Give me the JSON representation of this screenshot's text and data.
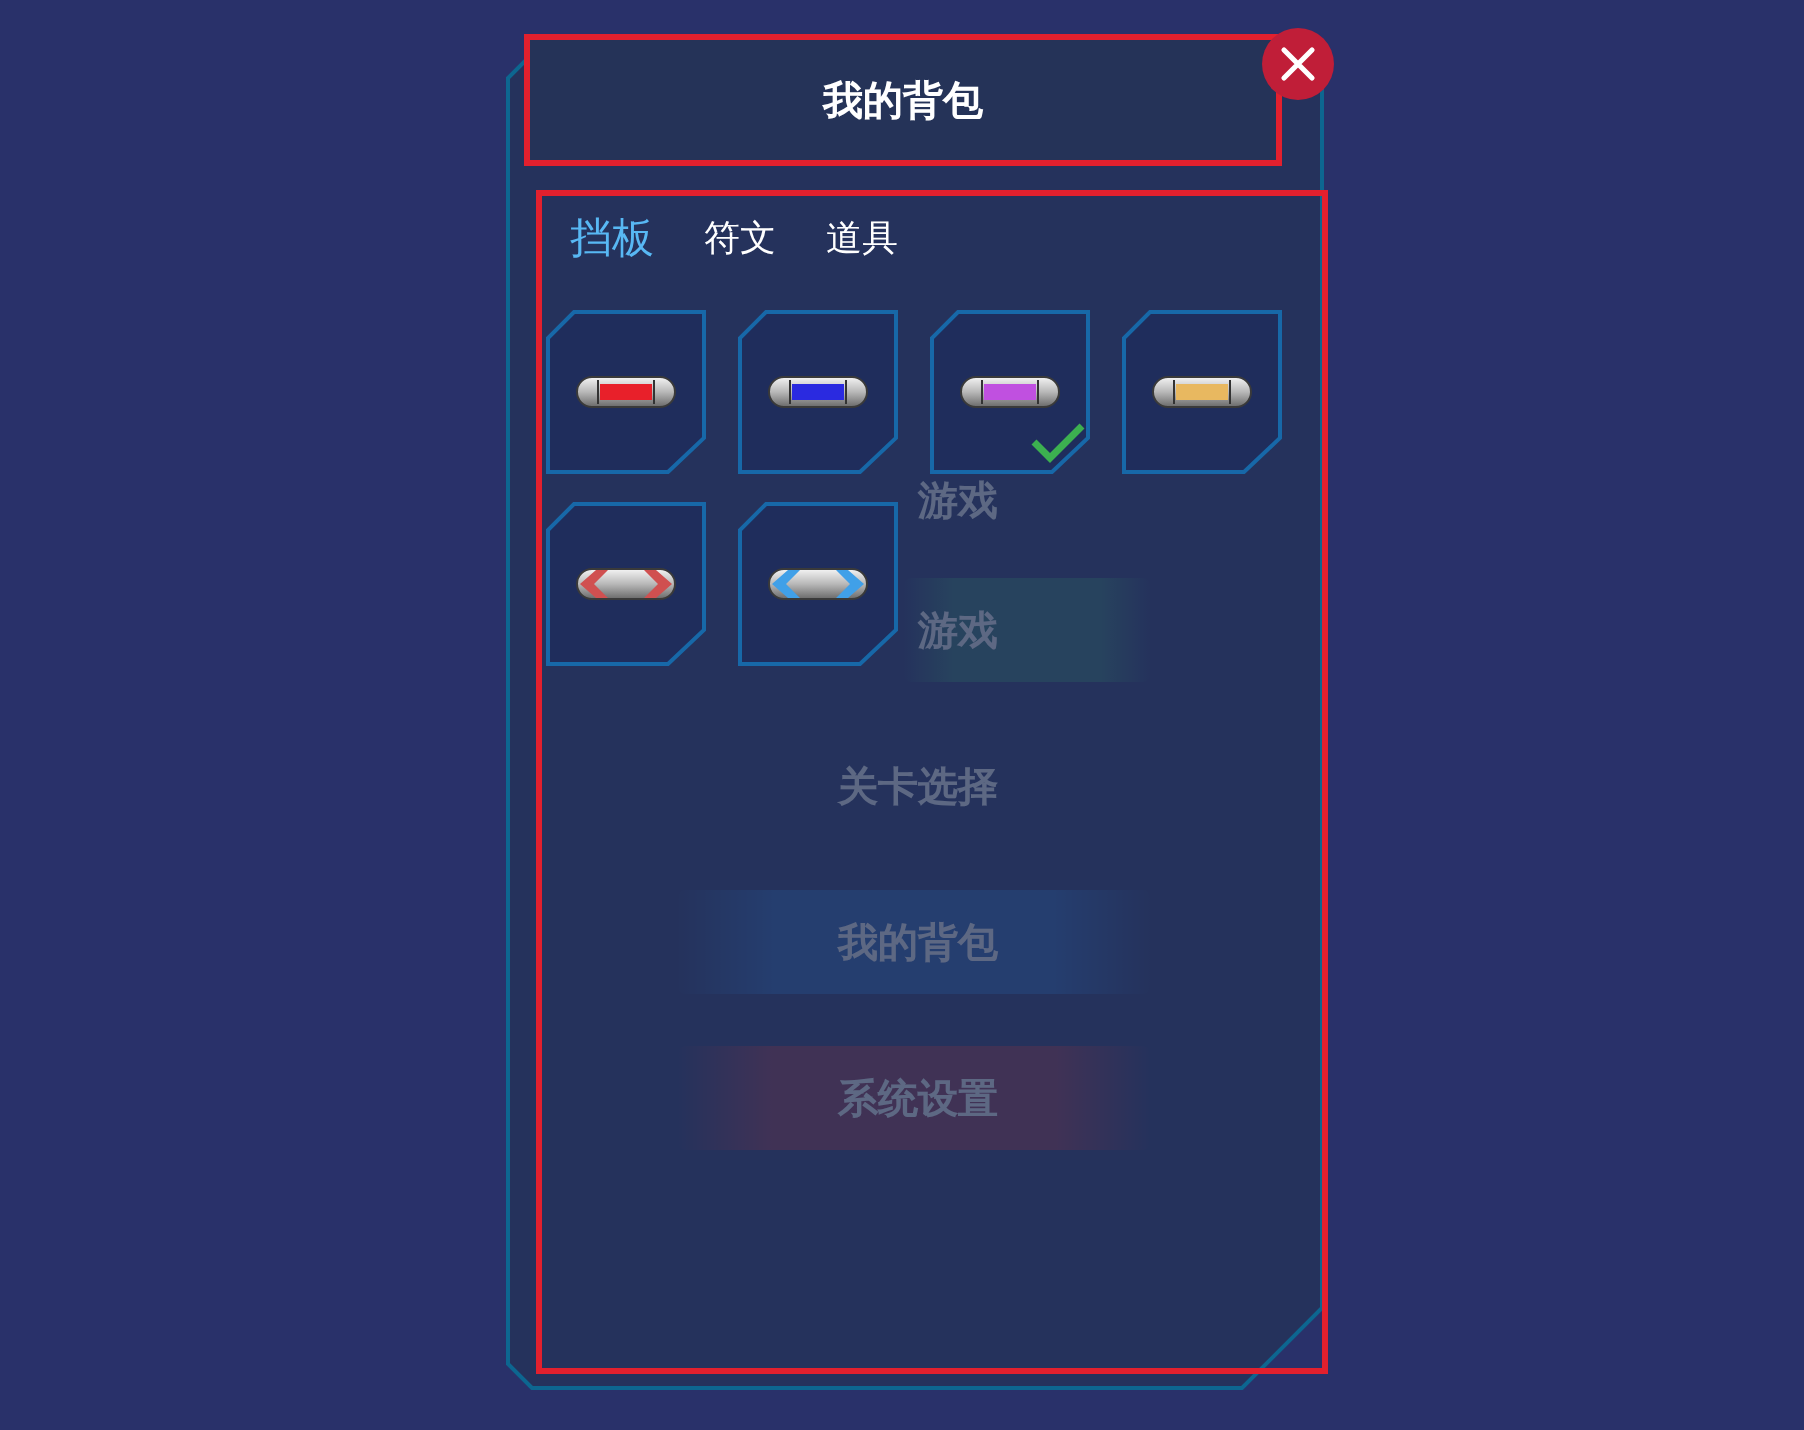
{
  "background_menu": [
    {
      "label": "游戏",
      "kind": "plain"
    },
    {
      "label": "游戏",
      "kind": "accent"
    },
    {
      "label": "关卡选择",
      "kind": "plain"
    },
    {
      "label": "我的背包",
      "kind": "primary"
    },
    {
      "label": "系统设置",
      "kind": "danger"
    }
  ],
  "dialog": {
    "title": "我的背包"
  },
  "tabs": [
    {
      "label": "挡板",
      "selected": true
    },
    {
      "label": "符文",
      "selected": false
    },
    {
      "label": "道具",
      "selected": false
    }
  ],
  "items": [
    {
      "kind": "bar",
      "color": "#e8202a",
      "selected": false
    },
    {
      "kind": "bar",
      "color": "#2a2ae0",
      "selected": false
    },
    {
      "kind": "bar",
      "color": "#c050e0",
      "selected": true
    },
    {
      "kind": "bar",
      "color": "#e8b860",
      "selected": false
    },
    {
      "kind": "arrows",
      "color": "#d05050",
      "selected": false
    },
    {
      "kind": "arrows",
      "color": "#40a0e8",
      "selected": false
    }
  ]
}
